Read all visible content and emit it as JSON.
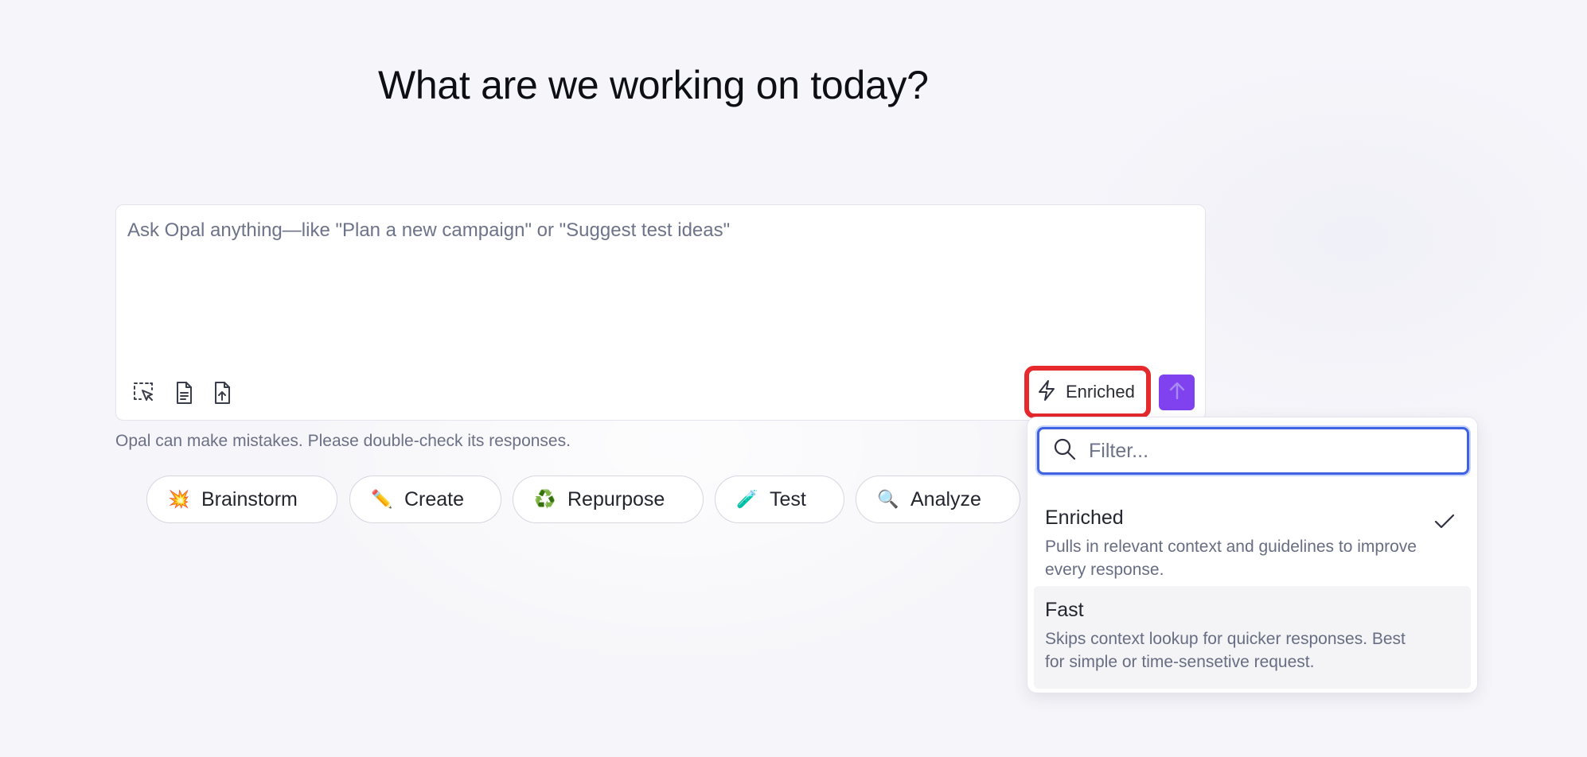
{
  "page": {
    "title": "What are we working on today?"
  },
  "composer": {
    "placeholder": "Ask Opal anything—like \"Plan a new campaign\" or \"Suggest test ideas\"",
    "tools": [
      {
        "icon": "select-area-icon"
      },
      {
        "icon": "document-icon"
      },
      {
        "icon": "file-upload-icon"
      }
    ],
    "mode_button": {
      "icon": "lightning-icon",
      "label": "Enriched"
    },
    "send_button": {
      "icon": "arrow-up-icon"
    }
  },
  "disclaimer": "Opal can make mistakes. Please double-check its responses.",
  "chips": [
    {
      "emoji": "💥",
      "label": "Brainstorm"
    },
    {
      "emoji": "✏️",
      "label": "Create"
    },
    {
      "emoji": "♻️",
      "label": "Repurpose"
    },
    {
      "emoji": "🧪",
      "label": "Test"
    },
    {
      "emoji": "🔍",
      "label": "Analyze"
    }
  ],
  "mode_dropdown": {
    "filter_placeholder": "Filter...",
    "options": [
      {
        "title": "Enriched",
        "description": "Pulls in relevant context and guidelines to improve every response.",
        "selected": true
      },
      {
        "title": "Fast",
        "description": "Skips context lookup for quicker responses. Best for simple or time-sensetive request.",
        "selected": false
      }
    ]
  },
  "colors": {
    "accent": "#8042ef",
    "highlight": "#e5292c",
    "focus_ring": "#3f62e3",
    "background": "#f6f6fa"
  }
}
